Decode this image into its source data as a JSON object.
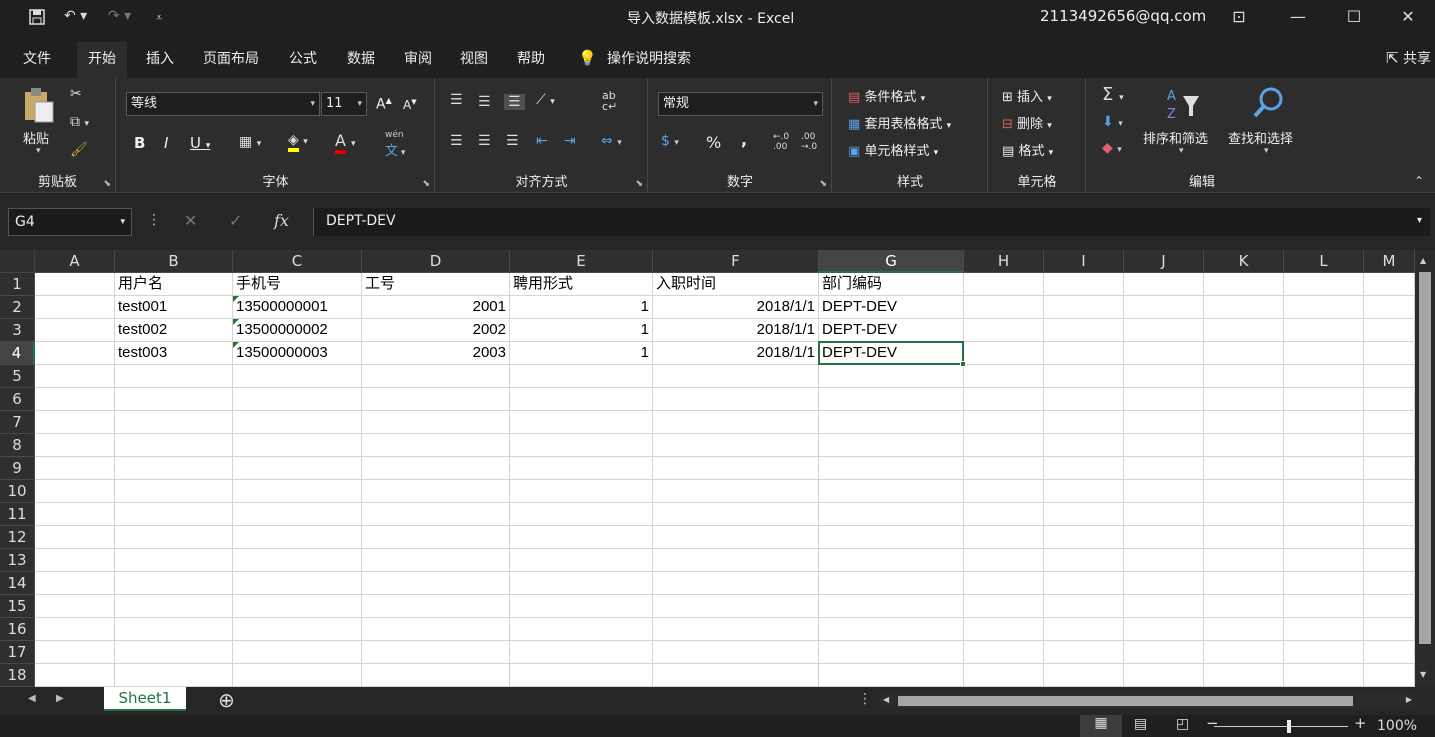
{
  "window": {
    "title": "导入数据模板.xlsx  -  Excel",
    "account": "2113492656@qq.com",
    "share": "共享"
  },
  "tabs": [
    "文件",
    "开始",
    "插入",
    "页面布局",
    "公式",
    "数据",
    "审阅",
    "视图",
    "帮助",
    "操作说明搜索"
  ],
  "ribbon": {
    "clipboard": {
      "label": "剪贴板",
      "paste": "粘贴"
    },
    "font": {
      "label": "字体",
      "name": "等线",
      "size": "11",
      "bold": "B",
      "italic": "I",
      "underline": "U",
      "grow": "A",
      "shrink": "A",
      "phonetic": "wén"
    },
    "alignment": {
      "label": "对齐方式"
    },
    "number": {
      "label": "数字",
      "format": "常规",
      "percent": "%",
      "comma": ","
    },
    "styles": {
      "label": "样式",
      "conditional": "条件格式",
      "table": "套用表格格式",
      "cell_styles": "单元格样式"
    },
    "cells": {
      "label": "单元格",
      "insert": "插入",
      "delete": "删除",
      "format": "格式"
    },
    "editing": {
      "label": "编辑",
      "sort": "排序和筛选",
      "find": "查找和选择"
    }
  },
  "formula_bar": {
    "name_box": "G4",
    "fx": "fx",
    "content": "DEPT-DEV"
  },
  "sheet": {
    "columns": [
      "A",
      "B",
      "C",
      "D",
      "E",
      "F",
      "G",
      "H",
      "I",
      "J",
      "K",
      "L",
      "M"
    ],
    "rows": [
      "1",
      "2",
      "3",
      "4",
      "5",
      "6",
      "7",
      "8",
      "9",
      "10",
      "11",
      "12",
      "13",
      "14",
      "15",
      "16",
      "17",
      "18"
    ],
    "selected_cell": "G4",
    "cells": [
      [
        "",
        "用户名",
        "手机号",
        "工号",
        "聘用形式",
        "入职时间",
        "部门编码"
      ],
      [
        "",
        "test001",
        "13500000001",
        "2001",
        "1",
        "2018/1/1",
        "DEPT-DEV"
      ],
      [
        "",
        "test002",
        "13500000002",
        "2002",
        "1",
        "2018/1/1",
        "DEPT-DEV"
      ],
      [
        "",
        "test003",
        "13500000003",
        "2003",
        "1",
        "2018/1/1",
        "DEPT-DEV"
      ]
    ]
  },
  "sheet_tabs": [
    "Sheet1"
  ],
  "status": {
    "zoom": "100%"
  }
}
